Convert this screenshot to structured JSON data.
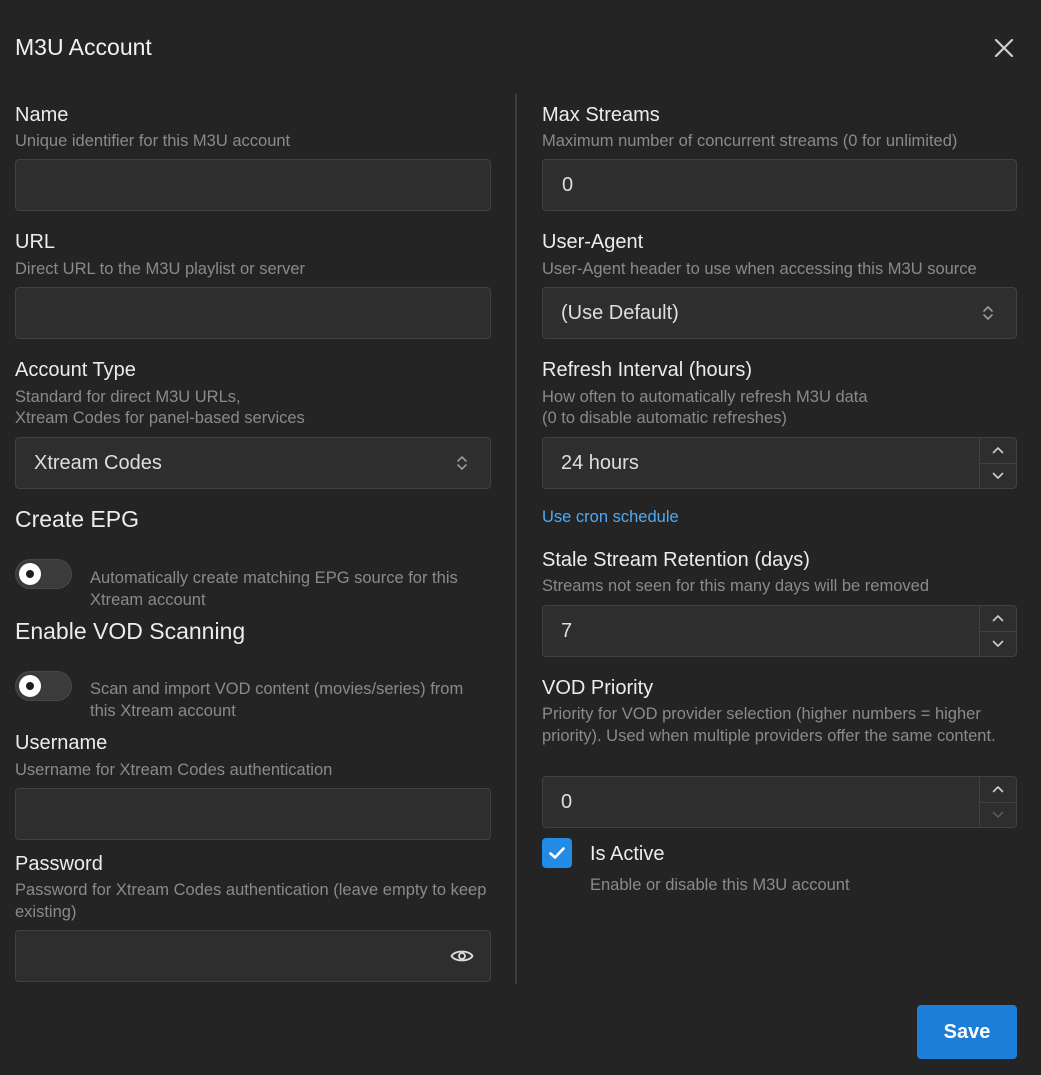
{
  "modal": {
    "title": "M3U Account",
    "save_label": "Save"
  },
  "left": {
    "name": {
      "label": "Name",
      "description": "Unique identifier for this M3U account",
      "value": ""
    },
    "url": {
      "label": "URL",
      "description": "Direct URL to the M3U playlist or server",
      "value": ""
    },
    "account_type": {
      "label": "Account Type",
      "description_line1": "Standard for direct M3U URLs,",
      "description_line2": "Xtream Codes for panel-based services",
      "selected": "Xtream Codes"
    },
    "create_epg": {
      "label": "Create EPG",
      "toggle_description": "Automatically create matching EPG source for this Xtream account",
      "enabled": false
    },
    "enable_vod": {
      "label": "Enable VOD Scanning",
      "toggle_description": "Scan and import VOD content (movies/series) from this Xtream account",
      "enabled": false
    },
    "username": {
      "label": "Username",
      "description": "Username for Xtream Codes authentication",
      "value": ""
    },
    "password": {
      "label": "Password",
      "description": "Password for Xtream Codes authentication (leave empty to keep existing)",
      "value": ""
    }
  },
  "right": {
    "max_streams": {
      "label": "Max Streams",
      "description": "Maximum number of concurrent streams (0 for unlimited)",
      "value": "0"
    },
    "user_agent": {
      "label": "User-Agent",
      "description": "User-Agent header to use when accessing this M3U source",
      "selected": "(Use Default)"
    },
    "refresh_interval": {
      "label": "Refresh Interval (hours)",
      "description_line1": "How often to automatically refresh M3U data",
      "description_line2": "(0 to disable automatic refreshes)",
      "value": "24 hours",
      "cron_link": "Use cron schedule"
    },
    "stale_retention": {
      "label": "Stale Stream Retention (days)",
      "description": "Streams not seen for this many days will be removed",
      "value": "7"
    },
    "vod_priority": {
      "label": "VOD Priority",
      "description": "Priority for VOD provider selection (higher numbers = higher priority). Used when multiple providers offer the same content.",
      "value": "0"
    },
    "is_active": {
      "label": "Is Active",
      "description": "Enable or disable this M3U account",
      "checked": true
    }
  },
  "colors": {
    "accent": "#228be6",
    "link": "#4dabf7",
    "background": "#242424"
  }
}
